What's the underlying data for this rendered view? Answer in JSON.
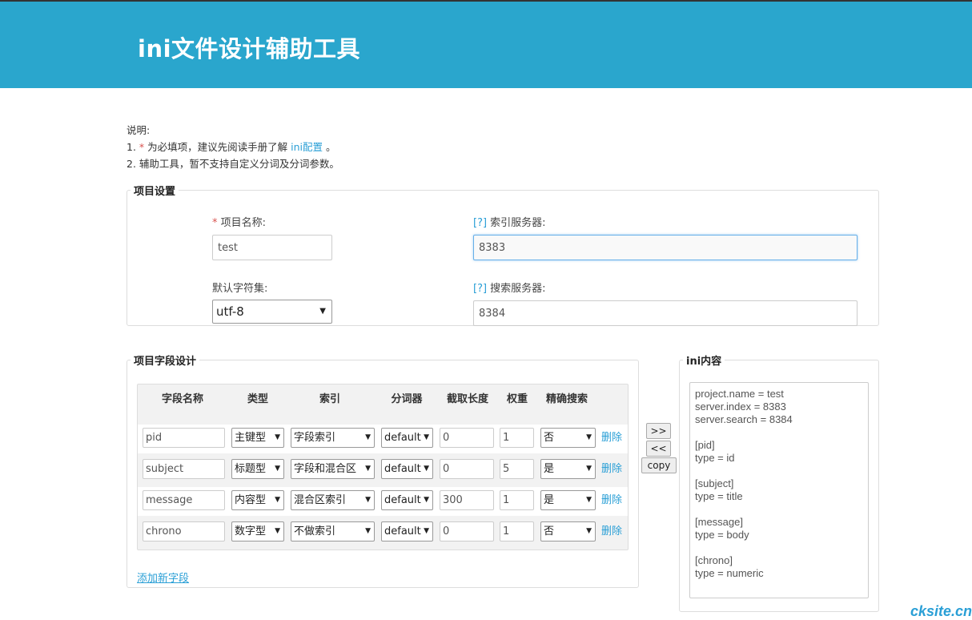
{
  "header": {
    "title": "ini文件设计辅助工具"
  },
  "notes": {
    "heading": "说明:",
    "line1_prefix": "1. ",
    "line1_star": "*",
    "line1_text": " 为必填项，建议先阅读手册了解 ",
    "line1_link": "ini配置",
    "line1_suffix": " 。",
    "line2": "2. 辅助工具，暂不支持自定义分词及分词参数。"
  },
  "project": {
    "legend": "项目设置",
    "name_star": "*",
    "name_label": " 项目名称:",
    "name_value": "test",
    "index_help": "[?]",
    "index_label": " 索引服务器:",
    "index_value": "8383",
    "charset_label": "默认字符集:",
    "charset_value": "utf-8",
    "search_help": "[?]",
    "search_label": " 搜索服务器:",
    "search_value": "8384"
  },
  "fields": {
    "legend": "项目字段设计",
    "headers": [
      "字段名称",
      "类型",
      "索引",
      "分词器",
      "截取长度",
      "权重",
      "精确搜索"
    ],
    "rows": [
      {
        "name": "pid",
        "type": "主键型",
        "index": "字段索引",
        "tokenizer": "default",
        "cut": "0",
        "weight": "1",
        "exact": "否",
        "delete": "删除"
      },
      {
        "name": "subject",
        "type": "标题型",
        "index": "字段和混合区",
        "tokenizer": "default",
        "cut": "0",
        "weight": "5",
        "exact": "是",
        "delete": "删除"
      },
      {
        "name": "message",
        "type": "内容型",
        "index": "混合区索引",
        "tokenizer": "default",
        "cut": "300",
        "weight": "1",
        "exact": "是",
        "delete": "删除"
      },
      {
        "name": "chrono",
        "type": "数字型",
        "index": "不做索引",
        "tokenizer": "default",
        "cut": "0",
        "weight": "1",
        "exact": "否",
        "delete": "删除"
      }
    ],
    "add_link": "添加新字段"
  },
  "buttons": {
    "to_right": ">>",
    "to_left": "<<",
    "copy": "copy"
  },
  "ini": {
    "legend": "ini内容",
    "content": "project.name = test\nserver.index = 8383\nserver.search = 8384\n\n[pid]\ntype = id\n\n[subject]\ntype = title\n\n[message]\ntype = body\n\n[chrono]\ntype = numeric"
  },
  "watermark": "cksite.cn"
}
